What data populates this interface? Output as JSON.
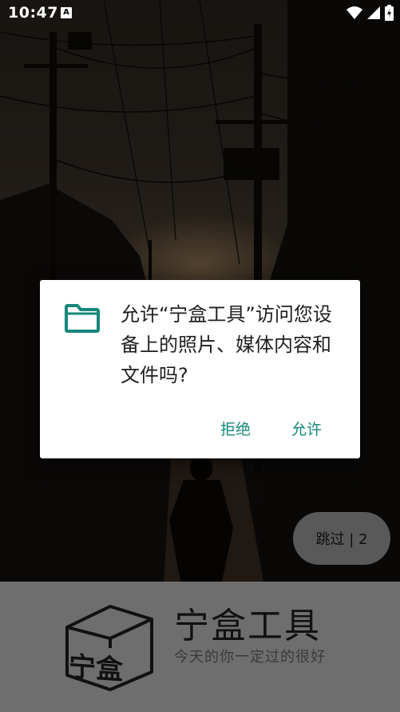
{
  "status_bar": {
    "time": "10:47",
    "notification_icon": "a-icon",
    "icons": [
      "wifi-icon",
      "signal-icon",
      "battery-charging-icon"
    ]
  },
  "dialog": {
    "icon": "folder-icon",
    "message": "允许“宁盒工具”访问您设备上的照片、媒体内容和文件吗?",
    "deny_label": "拒绝",
    "allow_label": "允许"
  },
  "skip": {
    "label": "跳过 | 2"
  },
  "banner": {
    "logo": "宁盒",
    "app_name": "宁盒工具",
    "slogan": "今天的你一定过的很好"
  },
  "colors": {
    "accent": "#16877a",
    "banner_bg": "#6e6e6e",
    "skip_bg": "#595959"
  }
}
